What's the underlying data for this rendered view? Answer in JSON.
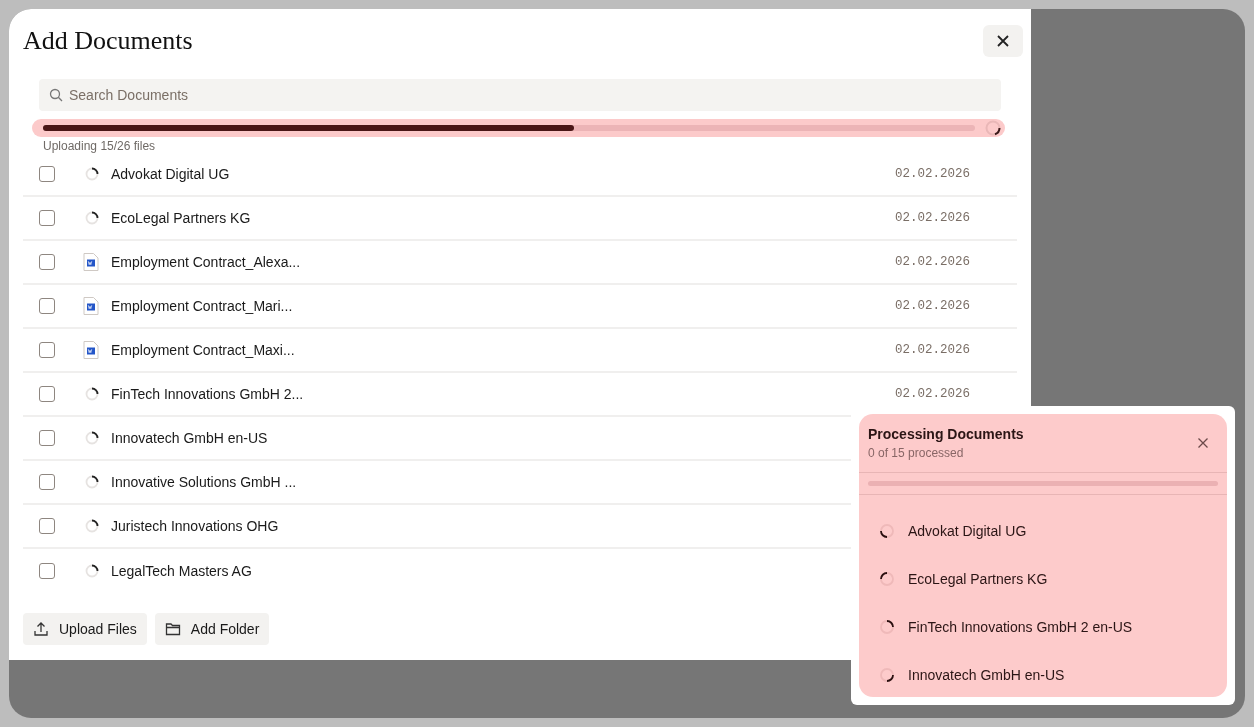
{
  "dialog": {
    "title": "Add Documents",
    "search": {
      "placeholder": "Search Documents"
    },
    "upload": {
      "level": 0.57,
      "status": "Uploading 15/26 files"
    },
    "rows": [
      {
        "kind": "loading",
        "name": "Advokat Digital UG",
        "date": "02.02.2026",
        "checked": false
      },
      {
        "kind": "loading",
        "name": "EcoLegal Partners KG",
        "date": "02.02.2026",
        "checked": false
      },
      {
        "kind": "word",
        "name": "Employment Contract_Alexa...",
        "date": "02.02.2026",
        "checked": false
      },
      {
        "kind": "word",
        "name": "Employment Contract_Mari...",
        "date": "02.02.2026",
        "checked": false
      },
      {
        "kind": "word",
        "name": "Employment Contract_Maxi...",
        "date": "02.02.2026",
        "checked": false
      },
      {
        "kind": "loading",
        "name": "FinTech Innovations GmbH 2...",
        "date": "02.02.2026",
        "checked": false
      },
      {
        "kind": "loading",
        "name": "Innovatech GmbH en-US",
        "checked": false
      },
      {
        "kind": "loading",
        "name": "Innovative Solutions GmbH ...",
        "checked": false
      },
      {
        "kind": "loading",
        "name": "Juristech Innovations OHG",
        "checked": false
      },
      {
        "kind": "loading",
        "name": "LegalTech Masters AG",
        "checked": false
      }
    ],
    "buttons": [
      {
        "kind": "upload",
        "label": "Upload Files"
      },
      {
        "kind": "folder",
        "label": "Add Folder"
      }
    ]
  },
  "processing": {
    "title": "Processing Documents",
    "subtitle": "0 of 15 processed",
    "level": 0,
    "items": [
      "Advokat Digital UG",
      "EcoLegal Partners KG",
      "FinTech Innovations GmbH 2 en-US",
      "Innovatech GmbH en-US"
    ]
  }
}
